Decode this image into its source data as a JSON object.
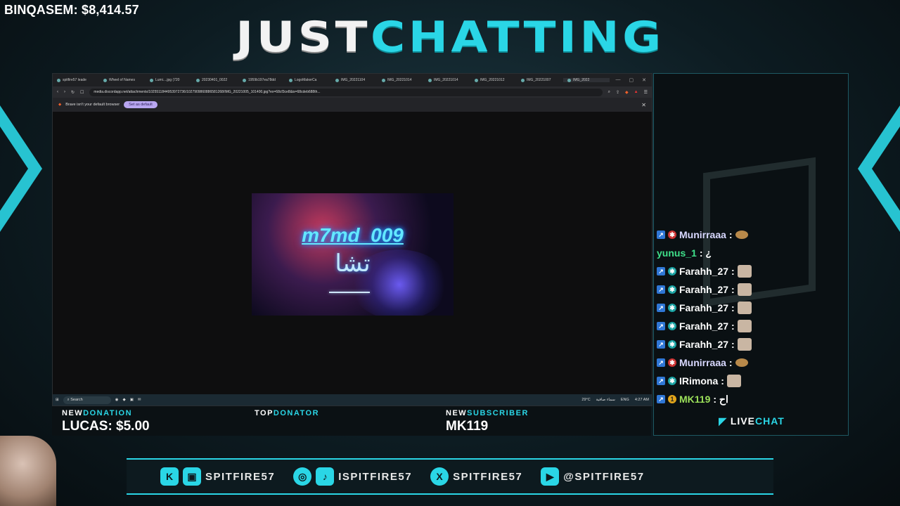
{
  "overlay": {
    "counter": "BINQASEM: $8,414.57",
    "title_part1": "JUST",
    "title_part2": "CHATTING",
    "accent_color": "#2ad6e6"
  },
  "browser": {
    "tabs": [
      "spitfire57 leade",
      "Wheel of Names",
      "Lumi....jpg (720",
      "20230401_0022",
      "1959b197ea78dd",
      "LogoMakerCa",
      "IMG_20221104",
      "IMG_20221014",
      "IMG_20221014",
      "IMG_20221012",
      "IMG_20221007",
      "IMG_2022"
    ],
    "url": "media.discordapp.net/attachments/1025511844953972736/1027909860886581268/IMG_20221005_101400.jpg?ex=68cf3ce8&is=68cdeb688th...",
    "infobar_text": "Brave isn't your default browser",
    "infobar_button": "Set as default",
    "image_name": "m7md_009",
    "image_arabic": "تشا",
    "taskbar_search": "Search",
    "weather": "29°C",
    "weather_ar": "سماء صافية",
    "lang": "ENG",
    "time": "4:27 AM"
  },
  "alerts": {
    "donation_label_a": "NEW",
    "donation_label_b": "DONATION",
    "donation_value": "LUCAS: $5.00",
    "top_label_a": "TOP",
    "top_label_b": "DONATOR",
    "sub_label_a": "NEW",
    "sub_label_b": "SUBSCRIBER",
    "sub_value": "MK119"
  },
  "chat": {
    "messages": [
      {
        "user": "Munirraaa",
        "sep": ":",
        "user_color": "#d8d8ff"
      },
      {
        "user": "yunus_1",
        "sep": ": ¿",
        "user_color": "#3fe08a"
      },
      {
        "user": "Farahh_27",
        "sep": ":",
        "user_color": "#ffffff"
      },
      {
        "user": "Farahh_27",
        "sep": ":",
        "user_color": "#ffffff"
      },
      {
        "user": "Farahh_27",
        "sep": ":",
        "user_color": "#ffffff"
      },
      {
        "user": "Farahh_27",
        "sep": ":",
        "user_color": "#ffffff"
      },
      {
        "user": "Farahh_27",
        "sep": ":",
        "user_color": "#ffffff"
      },
      {
        "user": "Munirraaa",
        "sep": ":",
        "user_color": "#d8d8ff"
      },
      {
        "user": "IRimona",
        "sep": ":",
        "user_color": "#ffffff"
      },
      {
        "user": "MK119",
        "sep": ": اح",
        "user_color": "#9be05a"
      }
    ],
    "footer_a": "LIVE",
    "footer_b": "CHAT"
  },
  "socials": {
    "kick_twitch": "SPITFIRE57",
    "instagram_tiktok": "ISPITFIRE57",
    "x": "SPITFIRE57",
    "youtube": "@SPITFIRE57"
  }
}
